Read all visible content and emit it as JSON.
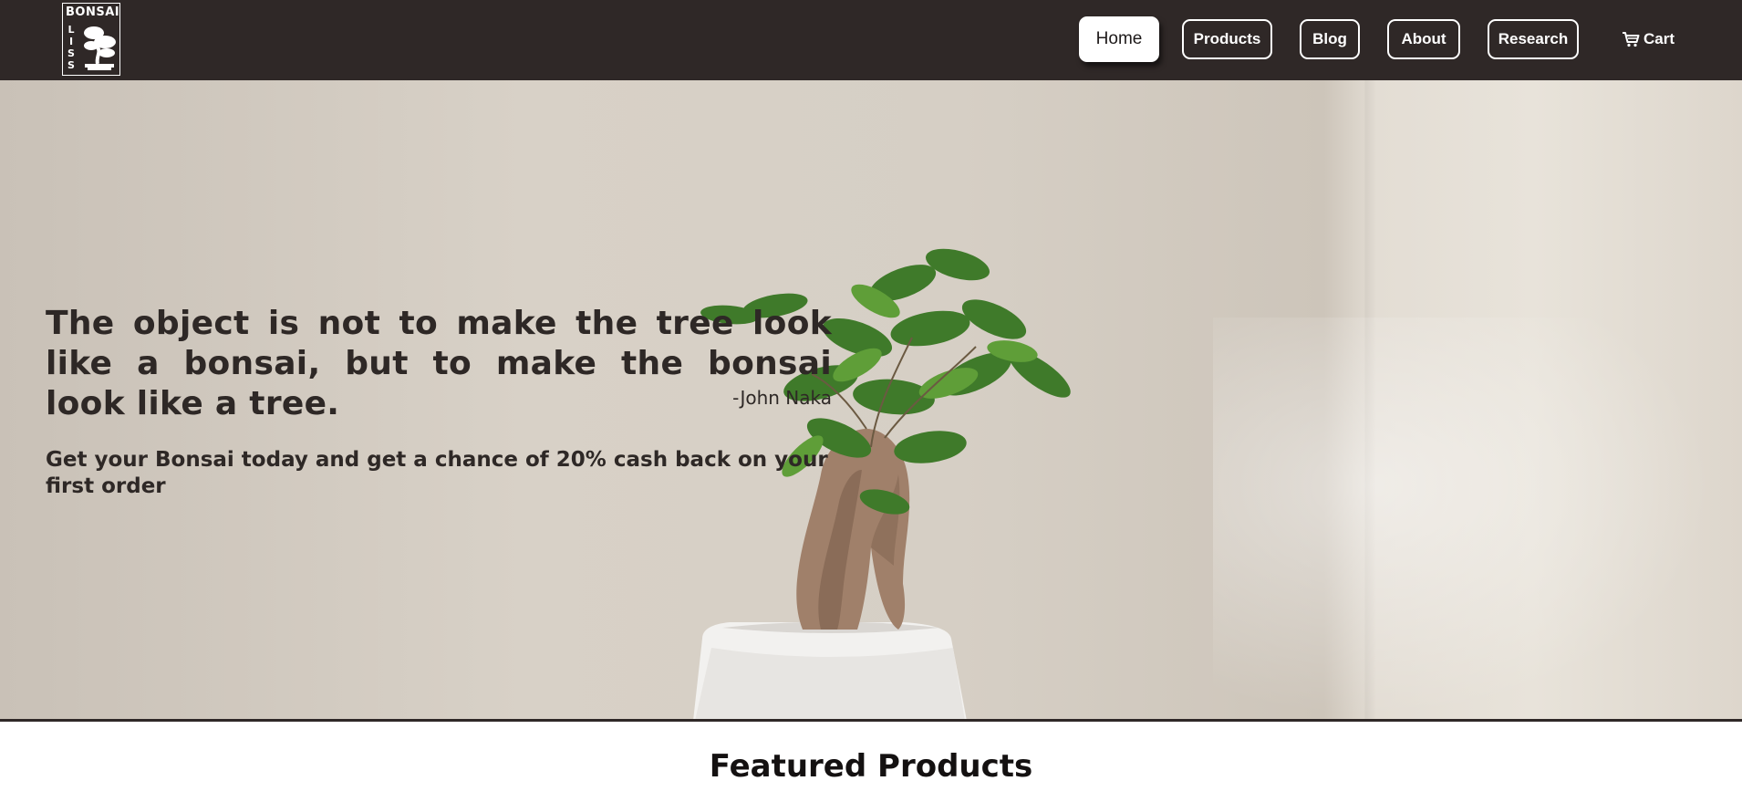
{
  "header": {
    "logo": {
      "word": "BONSAI",
      "vertical": [
        "L",
        "I",
        "S",
        "S"
      ]
    },
    "nav": [
      {
        "label": "Home",
        "active": true
      },
      {
        "label": "Products",
        "active": false
      },
      {
        "label": "Blog",
        "active": false
      },
      {
        "label": "About",
        "active": false
      },
      {
        "label": "Research",
        "active": false
      }
    ],
    "cart_label": "Cart",
    "cart_icon": "cart-icon"
  },
  "hero": {
    "quote": "The object is not to make the tree look like a bonsai, but to make the bonsai look like a tree.",
    "author": "-John Naka",
    "promo": "Get your Bonsai today and get a chance of 20% cash back on your first order"
  },
  "featured": {
    "title": "Featured Products"
  },
  "colors": {
    "header_bg": "#2f2827",
    "text": "#2e2826",
    "hero_bg": "#d6cfc5"
  }
}
